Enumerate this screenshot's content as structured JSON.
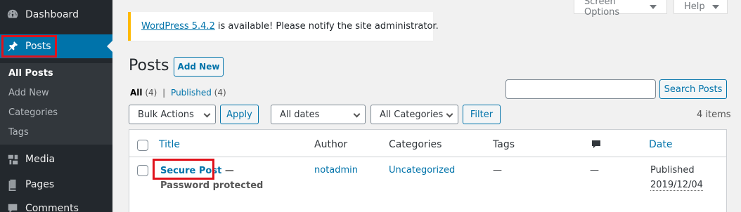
{
  "sidebar": {
    "dashboard": "Dashboard",
    "posts": "Posts",
    "submenu": [
      "All Posts",
      "Add New",
      "Categories",
      "Tags"
    ],
    "media": "Media",
    "pages": "Pages",
    "comments": "Comments"
  },
  "top": {
    "screen_options": "Screen Options",
    "help": "Help"
  },
  "notice": {
    "link": "WordPress 5.4.2",
    "text": "is available! Please notify the site administrator."
  },
  "page": {
    "title": "Posts",
    "add_new": "Add New"
  },
  "views": {
    "all": "All",
    "all_count": "(4)",
    "sep": "|",
    "published": "Published",
    "published_count": "(4)"
  },
  "search": {
    "button": "Search Posts",
    "value": ""
  },
  "filters": {
    "bulk_actions": "Bulk Actions",
    "apply": "Apply",
    "dates": "All dates",
    "categories": "All Categories",
    "filter": "Filter",
    "items_count": "4 items"
  },
  "table": {
    "headers": {
      "title": "Title",
      "author": "Author",
      "categories": "Categories",
      "tags": "Tags",
      "date": "Date"
    },
    "rows": [
      {
        "title": "Secure Post",
        "state": "— Password protected",
        "author": "notadmin",
        "categories": "Uncategorized",
        "tags": "—",
        "comments": "—",
        "status": "Published",
        "date": "2019/12/04"
      }
    ]
  },
  "colors": {
    "sidebar_bg": "#23282d",
    "accent": "#0073aa",
    "highlight_box": "#e0121b",
    "notice_border": "#ffb900"
  }
}
